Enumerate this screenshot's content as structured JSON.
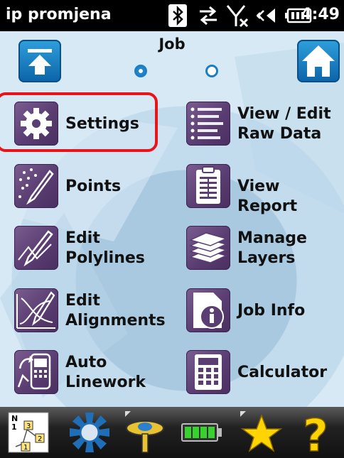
{
  "status_bar": {
    "app_name": "ip promjena",
    "time": "4:49",
    "icons": [
      "bluetooth-icon",
      "sync-arrows-icon",
      "no-signal-icon",
      "volume-icon",
      "battery-icon"
    ]
  },
  "header": {
    "title": "Job",
    "left_button_icon": "back-up-arrow-icon",
    "right_button_icon": "home-icon",
    "page_indicator": {
      "pages": 2,
      "current": 1
    }
  },
  "menu": {
    "items": [
      {
        "label": "Settings",
        "icon": "gear-icon",
        "highlighted": true
      },
      {
        "label": "View / Edit\nRaw Data",
        "icon": "raw-data-icon"
      },
      {
        "label": "Points",
        "icon": "points-icon"
      },
      {
        "label": "View Report",
        "icon": "report-icon"
      },
      {
        "label": "Edit\nPolylines",
        "icon": "polyline-icon"
      },
      {
        "label": "Manage\nLayers",
        "icon": "layers-icon"
      },
      {
        "label": "Edit\nAlignments",
        "icon": "alignment-icon"
      },
      {
        "label": "Job Info",
        "icon": "info-icon"
      },
      {
        "label": "Auto\nLinework",
        "icon": "linework-icon"
      },
      {
        "label": "Calculator",
        "icon": "calculator-icon"
      }
    ]
  },
  "taskbar": {
    "items": [
      {
        "icon": "north-map-icon",
        "label": "1 3 2 1"
      },
      {
        "icon": "gps-satellite-icon"
      },
      {
        "icon": "instrument-icon"
      },
      {
        "icon": "battery-full-icon"
      },
      {
        "icon": "favorites-star-icon"
      },
      {
        "icon": "help-icon"
      }
    ],
    "colors": {
      "star": "#ffd400",
      "help": "#ffd400"
    }
  },
  "colors": {
    "tile": "#5a3d72",
    "highlight": "#e8141a",
    "nav_button": "#1a7fc4"
  }
}
